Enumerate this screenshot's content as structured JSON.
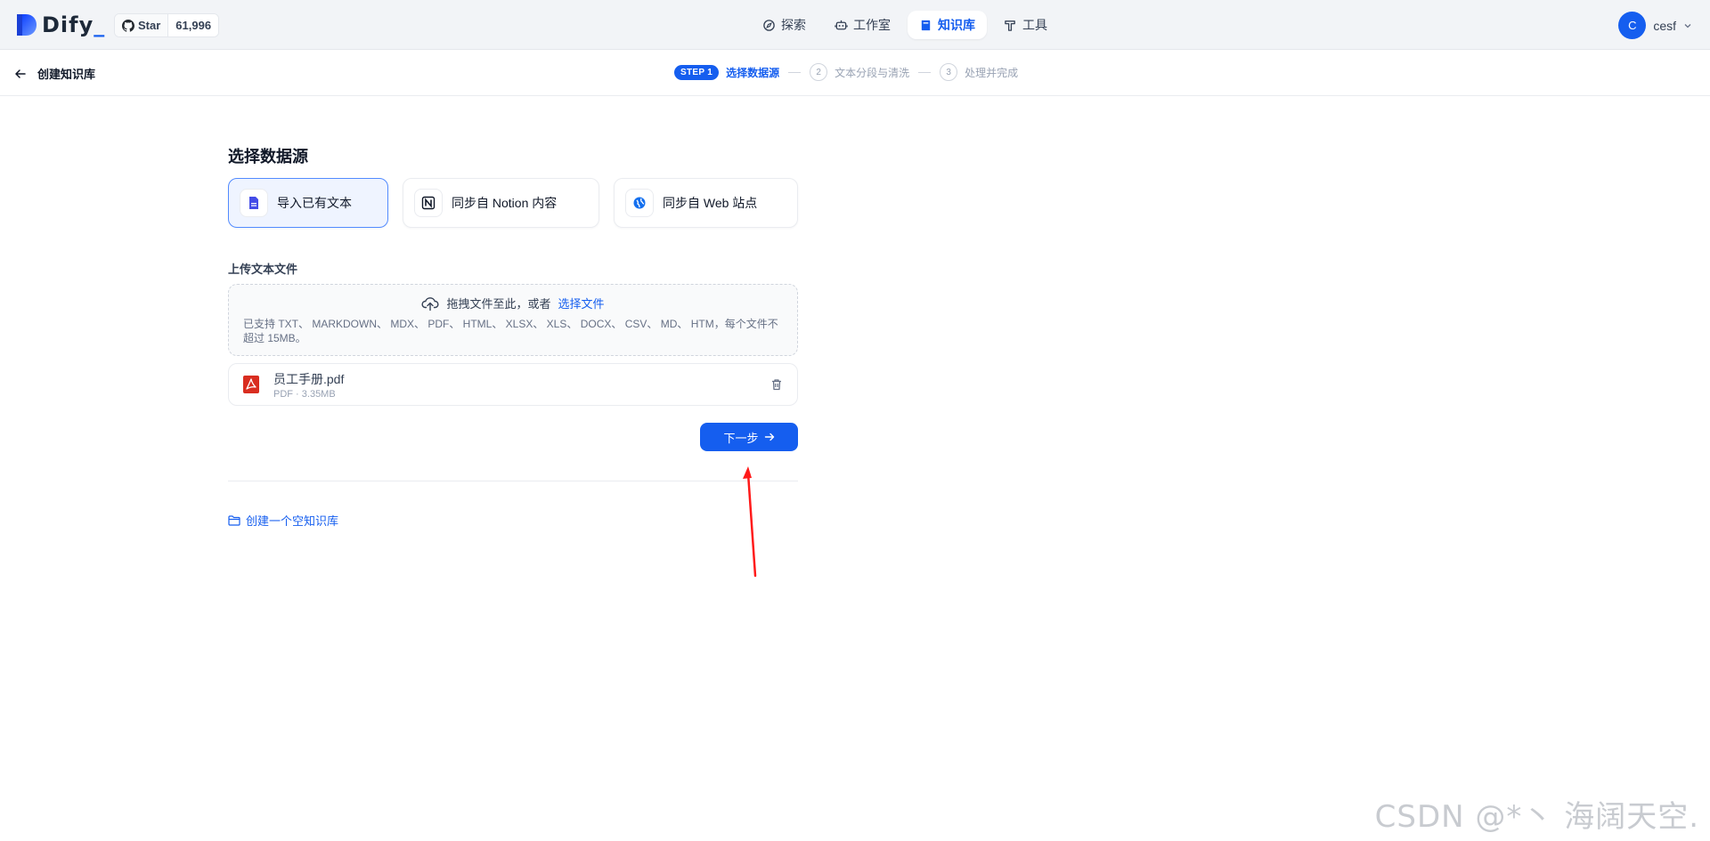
{
  "app": {
    "logo_text": "Dify",
    "brand_color": "#155eef"
  },
  "github": {
    "star_label": "Star",
    "star_count": "61,996"
  },
  "nav": {
    "items": [
      {
        "label": "探索",
        "icon": "explore-icon"
      },
      {
        "label": "工作室",
        "icon": "robot-icon"
      },
      {
        "label": "知识库",
        "icon": "book-icon",
        "active": true
      },
      {
        "label": "工具",
        "icon": "hammer-icon"
      }
    ]
  },
  "user": {
    "avatar_letter": "C",
    "name": "cesf"
  },
  "header": {
    "back_label": "创建知识库"
  },
  "steps": {
    "current_pill": "STEP 1",
    "current_label": "选择数据源",
    "step2_num": "2",
    "step2_label": "文本分段与清洗",
    "step3_num": "3",
    "step3_label": "处理并完成"
  },
  "main": {
    "title": "选择数据源",
    "sources": [
      {
        "label": "导入已有文本",
        "icon": "file-icon",
        "active": true
      },
      {
        "label": "同步自 Notion 内容",
        "icon": "notion-icon"
      },
      {
        "label": "同步自 Web 站点",
        "icon": "web-icon"
      }
    ],
    "upload_label": "上传文本文件",
    "dropzone": {
      "prompt": "拖拽文件至此，或者",
      "link": "选择文件",
      "hint": "已支持 TXT、 MARKDOWN、 MDX、 PDF、 HTML、 XLSX、 XLS、 DOCX、 CSV、 MD、 HTM，每个文件不超过 15MB。"
    },
    "file": {
      "name": "员工手册.pdf",
      "meta": "PDF · 3.35MB"
    },
    "next_button": "下一步",
    "create_empty": "创建一个空知识库"
  },
  "watermark": "CSDN @*丶 海阔天空."
}
